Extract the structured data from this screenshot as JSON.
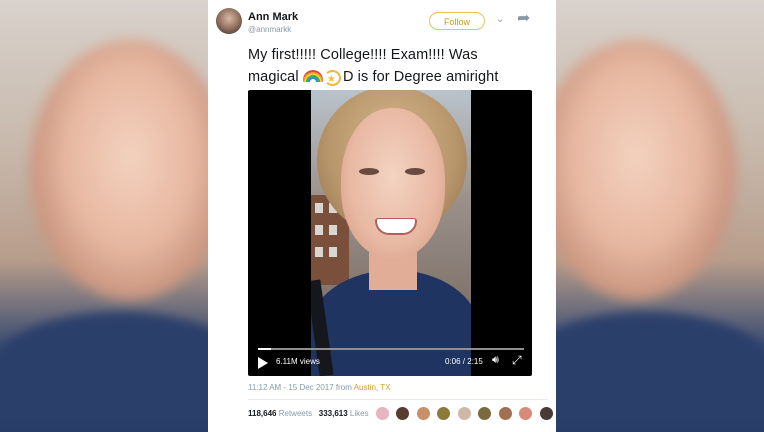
{
  "tweet": {
    "name": "Ann Mark",
    "handle": "@annmarkk",
    "follow_label": "Follow",
    "text_line1": "My first!!!!! College!!!! Exam!!!! Was",
    "text_line2_a": "magical",
    "text_line2_b": "D is for Degree amiright",
    "emojis": [
      "rainbow-icon",
      "dizzy-icon"
    ],
    "timestamp": "11:12 AM - 15 Dec 2017 from",
    "location": "Austin, TX",
    "retweets_count": "118,646",
    "retweets_label": "Retweets",
    "likes_count": "333,613",
    "likes_label": "Likes"
  },
  "video": {
    "views": "6.11M views",
    "time": "0:06 / 2:15",
    "progress": 0.05
  },
  "colors": {
    "follow_accent": "#e8c25a",
    "location": "#d19c2e",
    "muted": "#8899a6"
  }
}
